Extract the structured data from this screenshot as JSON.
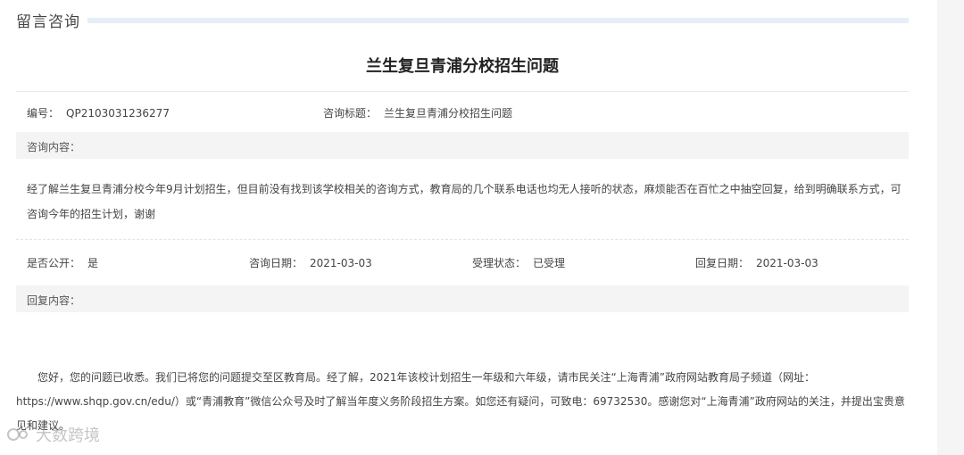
{
  "section_title": "留言咨询",
  "page_title": "兰生复旦青浦分校招生问题",
  "meta_top": {
    "number_label": "编号：",
    "number_value": "QP2103031236277",
    "topic_label": "咨询标题：",
    "topic_value": "兰生复旦青浦分校招生问题"
  },
  "inquiry": {
    "label": "咨询内容：",
    "text": "经了解兰生复旦青浦分校今年9月计划招生，但目前没有找到该学校相关的咨询方式，教育局的几个联系电话也均无人接听的状态，麻烦能否在百忙之中抽空回复，给到明确联系方式，可咨询今年的招生计划，谢谢"
  },
  "meta_bottom": {
    "public_label": "是否公开：",
    "public_value": "是",
    "date_label": "咨询日期：",
    "date_value": "2021-03-03",
    "status_label": "受理状态：",
    "status_value": "已受理",
    "reply_date_label": "回复日期：",
    "reply_date_value": "2021-03-03"
  },
  "reply": {
    "label": "回复内容：",
    "text": "您好，您的问题已收悉。我们已将您的问题提交至区教育局。经了解，2021年该校计划招生一年级和六年级，请市民关注“上海青浦”政府网站教育局子频道（网址：https://www.shqp.gov.cn/edu/）或“青浦教育”微信公众号及时了解当年度义务阶段招生方案。如您还有疑问，可致电：69732530。感谢您对“上海青浦”政府网站的关注，并提出宝贵意见和建议。"
  },
  "watermark": {
    "text": "大数跨境",
    "icon": "watermark-logo-icon"
  }
}
